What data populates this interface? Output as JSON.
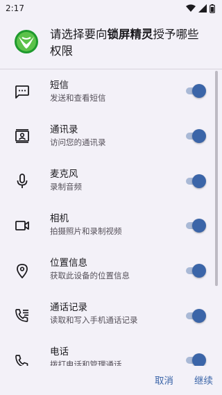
{
  "status_bar": {
    "time": "2:17"
  },
  "header": {
    "title_prefix": "请选择要向",
    "app_name": "锁屏精灵",
    "title_suffix": "授予哪些权限"
  },
  "permissions": [
    {
      "title": "短信",
      "desc": "发送和查看短信",
      "icon": "sms-icon",
      "enabled": true
    },
    {
      "title": "通讯录",
      "desc": "访问您的通讯录",
      "icon": "contacts-icon",
      "enabled": true
    },
    {
      "title": "麦克风",
      "desc": "录制音频",
      "icon": "microphone-icon",
      "enabled": true
    },
    {
      "title": "相机",
      "desc": "拍摄照片和录制视频",
      "icon": "camera-icon",
      "enabled": true
    },
    {
      "title": "位置信息",
      "desc": "获取此设备的位置信息",
      "icon": "location-icon",
      "enabled": true
    },
    {
      "title": "通话记录",
      "desc": "读取和写入手机通话记录",
      "icon": "call-log-icon",
      "enabled": true
    },
    {
      "title": "电话",
      "desc": "拨打电话和管理通话",
      "icon": "phone-icon",
      "enabled": true
    }
  ],
  "footer": {
    "cancel_label": "取消",
    "continue_label": "继续"
  },
  "colors": {
    "accent": "#3b65a8",
    "track": "#a9b9d6",
    "background": "#f3f1f8"
  }
}
